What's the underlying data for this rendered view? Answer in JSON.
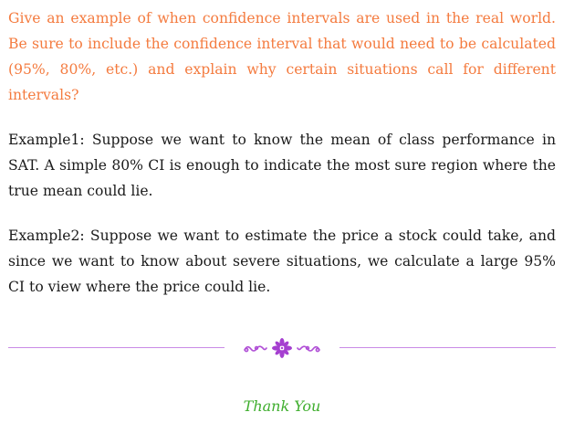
{
  "question": "Give an example of when confidence intervals are used in the real world. Be sure to include the confidence interval that would need to be calculated (95%, 80%, etc.)  and explain why certain situations call for different intervals?",
  "examples": [
    "Example1: Suppose we want to know the mean of class performance in SAT. A simple 80% CI is enough to indicate the most sure region where the true mean could lie.",
    "Example2: Suppose we want to estimate the price a stock could take, and since we want to know about severe situations, we calculate a large 95% CI to view where the price could lie."
  ],
  "divider": {
    "ornament_icon": "floral-ornament-icon",
    "color": "#c98be6"
  },
  "closing": "Thank You",
  "colors": {
    "question": "#f47b3f",
    "body": "#1a1a1a",
    "closing": "#3fae2e"
  }
}
